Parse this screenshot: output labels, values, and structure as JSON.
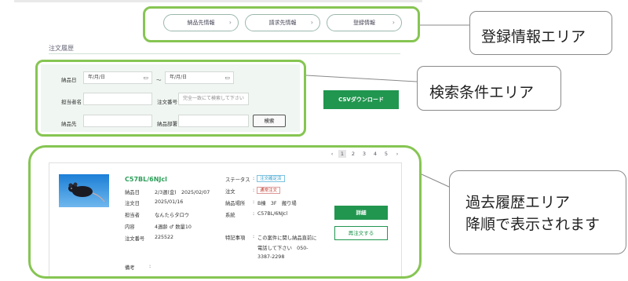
{
  "top_buttons": [
    {
      "label": "納品先情報"
    },
    {
      "label": "請求先情報"
    },
    {
      "label": "登録情報"
    }
  ],
  "section_title": "注文履歴",
  "search": {
    "order_date_label": "納品日",
    "date_placeholder": "年/月/日",
    "tilde": "～",
    "person_label": "担当者名",
    "order_no_label": "注文番号",
    "order_no_placeholder": "完全一致にて検索して下さい",
    "delivery_label": "納品先",
    "dept_label": "納品部署",
    "search_button": "検索"
  },
  "csv_button": "CSVダウンロード",
  "pagination": {
    "prev": "‹",
    "pages": [
      "1",
      "2",
      "3",
      "4",
      "5"
    ],
    "next": "›",
    "active": "1"
  },
  "order": {
    "title": "C57BL/6NJcl",
    "fields_left": [
      {
        "key": "納品日",
        "value": "2/3週(金)　2025/02/07"
      },
      {
        "key": "注文日",
        "value": "2025/01/16"
      },
      {
        "key": "担当者",
        "value": "なんたらタロウ"
      },
      {
        "key": "内容",
        "value": "4週齢 ♂ 数量10"
      },
      {
        "key": "注文番号",
        "value": "225522"
      },
      {
        "key": "備考",
        "value": ""
      }
    ],
    "status_label": "ステータス",
    "status_value": "注文確定済",
    "order_label": "注文",
    "order_value": "通常注文",
    "place_label": "納品場所",
    "place_value": "B棟　3F　搬り場",
    "line_label": "系統",
    "line_value": "C57BL/6NJcl",
    "notes_label": "特記事項",
    "notes_lines": [
      "この案件に関し納品直前に",
      "電話して下さい　050-",
      "3387-2298"
    ],
    "detail_button": "詳細",
    "reorder_button": "再注文する"
  },
  "callouts": {
    "registration": "登録情報エリア",
    "search": "検索条件エリア",
    "history_line1": "過去履歴エリア",
    "history_line2": "降順で表示されます"
  },
  "colors": {
    "highlight": "#86c552",
    "primary_green": "#21964f",
    "search_bg": "#f0f6f2"
  },
  "icons": [
    "calendar-icon",
    "chevron-right-icon",
    "mouse-photo"
  ]
}
